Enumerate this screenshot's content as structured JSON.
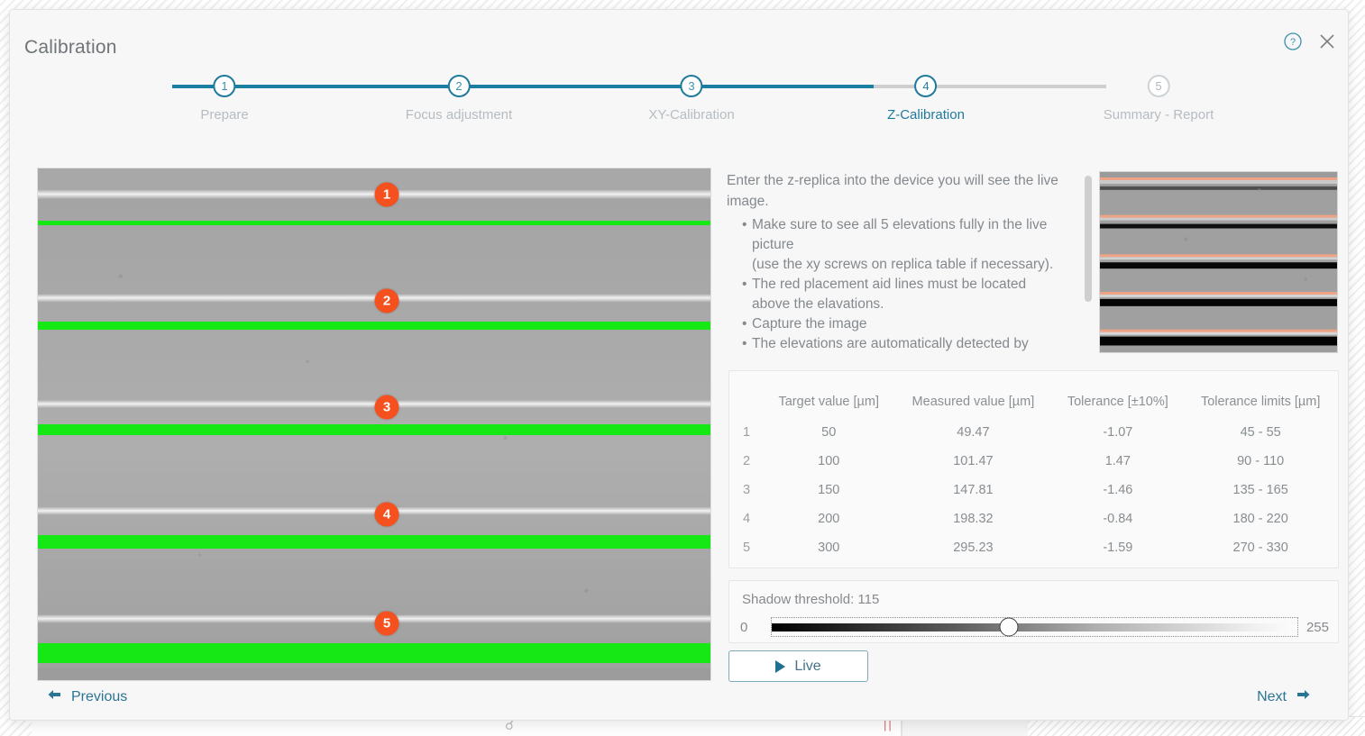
{
  "dialog": {
    "title": "Calibration",
    "help_icon": "help-circle-icon",
    "close_icon": "close-icon"
  },
  "stepper": {
    "current_step": 4,
    "active_color": "#1f7a9c",
    "inactive_color": "#b6bcc1",
    "steps": [
      {
        "number": "1",
        "label": "Prepare"
      },
      {
        "number": "2",
        "label": "Focus adjustment"
      },
      {
        "number": "3",
        "label": "XY-Calibration"
      },
      {
        "number": "4",
        "label": "Z-Calibration"
      },
      {
        "number": "5",
        "label": "Summary - Report"
      }
    ]
  },
  "instructions": {
    "lead": "Enter the z-replica into the device you will see the live image.",
    "bullets": [
      "Make sure to see all 5 elevations fully in the live picture\n(use the xy screws on replica table if necessary).",
      "The red placement aid lines must be located\n above the elavations.",
      "Capture the image",
      "The elevations are automatically detected by\n the programme. Check the tolerances and"
    ]
  },
  "live_image": {
    "badges": [
      "1",
      "2",
      "3",
      "4",
      "5"
    ],
    "badge_color": "#f4511e",
    "detection_line_color": "#15e814"
  },
  "table": {
    "columns": [
      "",
      "Target value [µm]",
      "Measured value [µm]",
      "Tolerance [±10%]",
      "Tolerance limits [µm]"
    ],
    "rows": [
      {
        "index": "1",
        "target": "50",
        "measured": "49.47",
        "tolerance": "-1.07",
        "limits": "45 - 55"
      },
      {
        "index": "2",
        "target": "100",
        "measured": "101.47",
        "tolerance": "1.47",
        "limits": "90 - 110"
      },
      {
        "index": "3",
        "target": "150",
        "measured": "147.81",
        "tolerance": "-1.46",
        "limits": "135 - 165"
      },
      {
        "index": "4",
        "target": "200",
        "measured": "198.32",
        "tolerance": "-0.84",
        "limits": "180 - 220"
      },
      {
        "index": "5",
        "target": "300",
        "measured": "295.23",
        "tolerance": "-1.59",
        "limits": "270 - 330"
      }
    ]
  },
  "slider": {
    "label": "Shadow threshold: 115",
    "value": 115,
    "min_label": "0",
    "max_label": "255",
    "min": 0,
    "max": 255
  },
  "live_button": {
    "label": "Live",
    "icon": "play-icon"
  },
  "footer": {
    "previous_label": "Previous",
    "next_label": "Next",
    "previous_icon": "arrow-left-icon",
    "next_icon": "arrow-right-icon",
    "link_color": "#2a7593"
  }
}
